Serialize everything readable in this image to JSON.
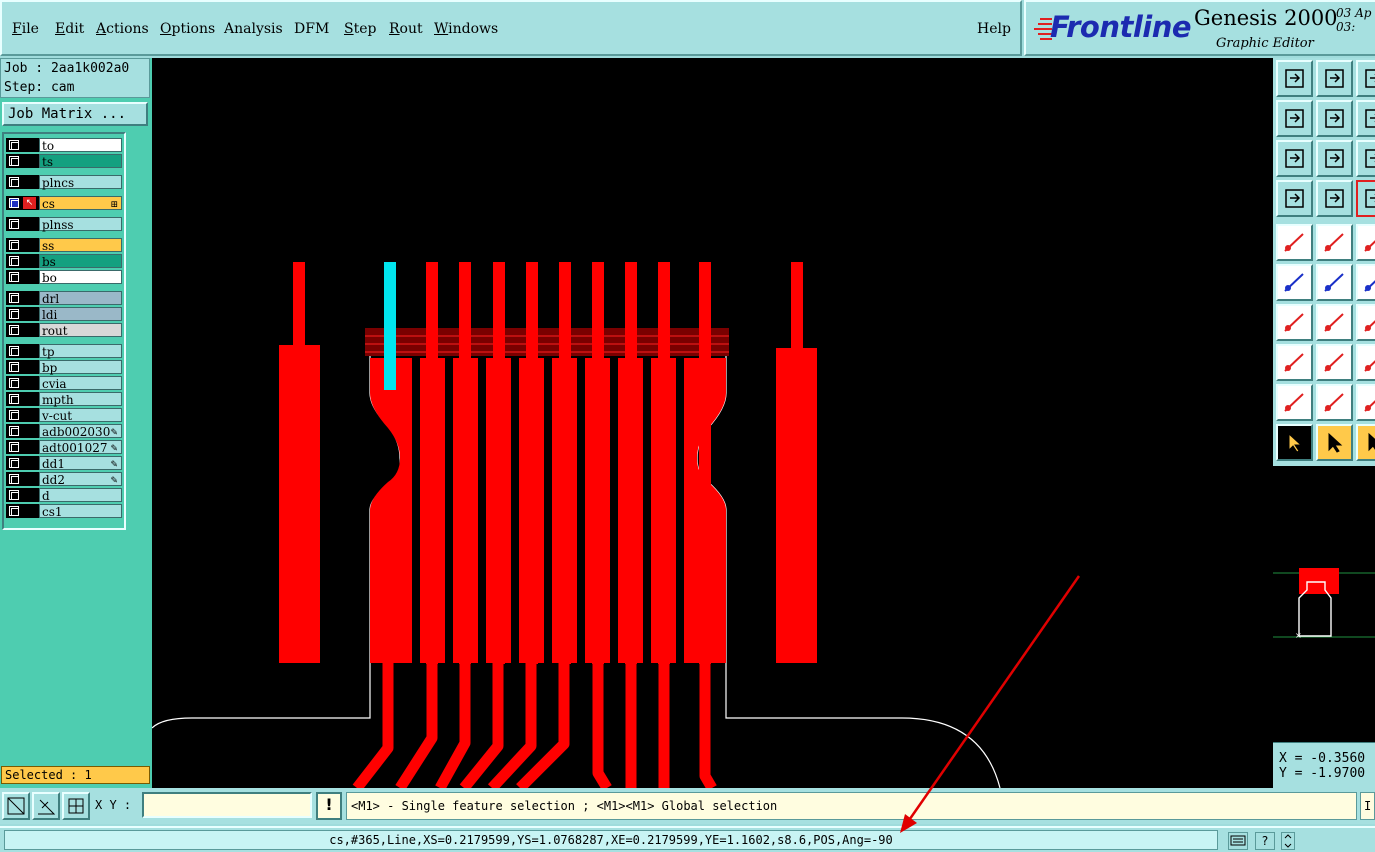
{
  "menu": {
    "items": [
      "File",
      "Edit",
      "Actions",
      "Options",
      "Analysis",
      "DFM",
      "Step",
      "Rout",
      "Windows"
    ],
    "help": "Help"
  },
  "brand": {
    "logo": "Frontline",
    "product": "Genesis 2000",
    "date_line1": "03  Ap",
    "date_line2": "03:",
    "subtitle": "Graphic Editor"
  },
  "job": {
    "job_line": "Job : 2aa1k002a0",
    "step_line": "Step: cam",
    "matrix_button": "Job Matrix ..."
  },
  "layers": [
    {
      "name": "to",
      "color": "#ffffff"
    },
    {
      "name": "ts",
      "color": "#14a080"
    },
    {
      "name": "plncs",
      "color": "#a6e0e0"
    },
    {
      "name": "cs",
      "color": "#ffc94a",
      "active": true
    },
    {
      "name": "plnss",
      "color": "#a6e0e0"
    },
    {
      "name": "ss",
      "color": "#ffc94a"
    },
    {
      "name": "bs",
      "color": "#14a080"
    },
    {
      "name": "bo",
      "color": "#ffffff"
    },
    {
      "name": "drl",
      "color": "#9ab8c8"
    },
    {
      "name": "ldi",
      "color": "#9ab8c8"
    },
    {
      "name": "rout",
      "color": "#d8d8d8"
    },
    {
      "name": "tp",
      "color": "#a6e0e0"
    },
    {
      "name": "bp",
      "color": "#a6e0e0"
    },
    {
      "name": "cvia",
      "color": "#a6e0e0"
    },
    {
      "name": "mpth",
      "color": "#a6e0e0"
    },
    {
      "name": "v-cut",
      "color": "#a6e0e0"
    },
    {
      "name": "adb002030",
      "color": "#a6e0e0",
      "tag": true
    },
    {
      "name": "adt001027",
      "color": "#a6e0e0",
      "tag": true
    },
    {
      "name": "dd1",
      "color": "#a6e0e0",
      "tag": true
    },
    {
      "name": "dd2",
      "color": "#a6e0e0",
      "tag": true
    },
    {
      "name": "d",
      "color": "#a6e0e0"
    },
    {
      "name": "cs1",
      "color": "#a6e0e0"
    }
  ],
  "selected": "Selected : 1",
  "coords": {
    "x": "X = -0.3560",
    "y": "Y = -1.9700"
  },
  "cmd": {
    "xy_label": "X Y :",
    "xy_value": "",
    "warn": "!",
    "prompt": "<M1> - Single feature selection ; <M1><M1> Global selection",
    "prompt_end": "I"
  },
  "status": {
    "text": "cs,#365,Line,XS=0.2179599,YS=1.0768287,XE=0.2179599,YE=1.1602,s8.6,POS,Ang=-90",
    "help_icon": "?"
  },
  "colors": {
    "feature": "#ff0000",
    "highlight": "#00e5ee",
    "outline": "#ffffff",
    "annotation": "#e00000"
  }
}
